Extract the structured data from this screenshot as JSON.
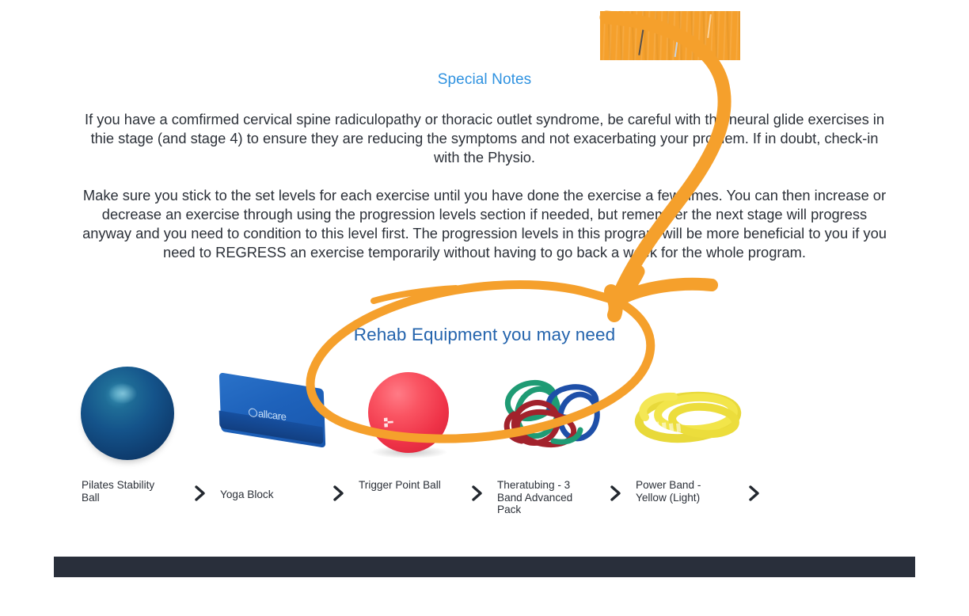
{
  "document": {
    "special_notes_heading": "Special Notes",
    "paragraph_1": "If you have a comfirmed cervical spine radiculopathy or thoracic outlet syndrome, be careful with the neural glide exercises in thie stage (and stage 4) to ensure they are reducing the symptoms and not exacerbating your problem. If in doubt, check-in with the Physio.",
    "paragraph_2": "Make sure you stick to the set levels for each exercise until you have done the exercise a few times. You can then increase or decrease an exercise through using the progression levels section if needed, but remember the next stage will progress anyway and you need to condition to this level first. The progression levels in this program will be more beneficial to you if you need to REGRESS an exercise temporarily without having to go back a week for the whole program.",
    "equipment_heading": "Rehab Equipment you may need"
  },
  "equipment": {
    "items": [
      {
        "name": "Pilates Stability Ball",
        "image": "blue-pilates-ball-image",
        "chevron": "chevron-right-icon"
      },
      {
        "name": "Yoga Block",
        "image": "blue-yoga-block-image",
        "brand": "allcare",
        "chevron": "chevron-right-icon"
      },
      {
        "name": "Trigger Point Ball",
        "image": "red-trigger-point-ball-image",
        "chevron": "chevron-right-icon"
      },
      {
        "name": "Theratubing - 3 Band Advanced Pack",
        "image": "coloured-theratubing-image",
        "chevron": "chevron-right-icon"
      },
      {
        "name": "Power Band - Yellow (Light)",
        "image": "yellow-power-band-image",
        "chevron": "chevron-right-icon"
      }
    ]
  },
  "annotations": {
    "highlight_color": "#f5a02c",
    "arrow": "orange-hand-drawn-arrow",
    "ellipse": "orange-hand-drawn-ellipse",
    "block": "orange-highlight-block"
  },
  "colors": {
    "heading_blue": "#2f92e0",
    "equipment_heading_blue": "#2464ad",
    "body_text": "#2b3038",
    "footer_bar": "#292f3b",
    "annotation_orange": "#f5a02c"
  }
}
